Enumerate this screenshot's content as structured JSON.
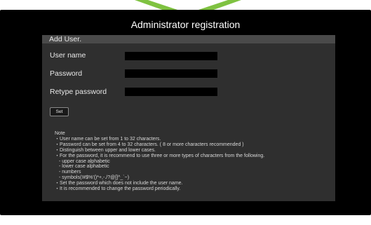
{
  "title": "Administrator registration",
  "form": {
    "header": "Add User.",
    "fields": [
      {
        "label": "User name",
        "value": ""
      },
      {
        "label": "Password",
        "value": ""
      },
      {
        "label": "Retype password",
        "value": ""
      }
    ],
    "set_label": "Set"
  },
  "note": {
    "heading": "Note",
    "lines": [
      "・User name can be set from 1 to 32 characters.",
      "・Password can be set from 4 to 32 characters. ( 8 or more characters recommended )",
      "・Distinguish between upper and lower cases.",
      "・For the password, it is  recommend to use three or more types of characters from the following.",
      "- upper case alphabetic",
      "- lower case alphabetic",
      "- numbers",
      "- symbols(!#$%'()*+,-./?@[]^_`~)",
      "・Set the password which does not include the user name.",
      "・It is recommended to change the password periodically."
    ]
  },
  "colors": {
    "accent_arrow": "#7fc241",
    "screen_bg": "#000000",
    "panel_bg": "#2f2f2f",
    "header_bg": "#4a4a4a"
  }
}
